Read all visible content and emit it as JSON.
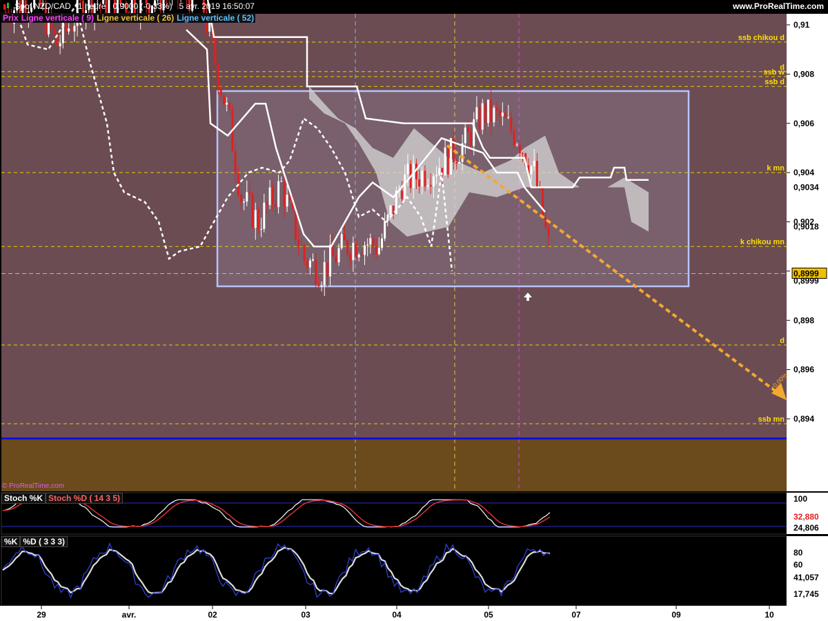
{
  "header": {
    "instrument": "Spot NZD/CAD",
    "timeframe": "1 heure",
    "price_change": "0,9000 (-0,33%)",
    "datetime": "5 avr. 2019 16:50:07",
    "site": "www.ProRealTime.com"
  },
  "legend": {
    "prix": "Prix",
    "line9": "Ligne verticale ( 9)",
    "line26": "Ligne verticale ( 26)",
    "line52": "Ligne verticale ( 52)"
  },
  "copyright": "© ProRealTime.com",
  "colors": {
    "background_main": "#6b4c52",
    "background_low": "#6b4a1c",
    "support_line": "#1010e0",
    "level_line": "#e8d000",
    "projection_arrow": "#f4a830",
    "box": "#b8c4ff",
    "bull": "#ffffff",
    "bear": "#e02020"
  },
  "chart_data": [
    {
      "type": "candlestick",
      "name": "price",
      "ylim": [
        0.8925,
        0.9115
      ],
      "y_ticks": [
        "0,91",
        "0,908",
        "0,906",
        "0,904",
        "0,902",
        "0,9",
        "0,898",
        "0,896",
        "0,894"
      ],
      "x_ticks": [
        "29",
        "avr.",
        "02",
        "03",
        "04",
        "05",
        "07",
        "09",
        "10"
      ],
      "levels": [
        {
          "label": "ssb chikou d",
          "value": 0.9093
        },
        {
          "label": "d",
          "value": 0.9081
        },
        {
          "label": "ssb w",
          "value": 0.9079
        },
        {
          "label": "ssb d",
          "value": 0.9075
        },
        {
          "label": "k mn",
          "value": 0.904
        },
        {
          "label": "k chikou mn",
          "value": 0.901
        },
        {
          "label": "d",
          "value": 0.897
        },
        {
          "label": "ssb mn",
          "value": 0.8938
        }
      ],
      "price_labels": [
        {
          "text": "0,9034",
          "value": 0.9034
        },
        {
          "text": "0,9018",
          "value": 0.9018
        },
        {
          "text": "0,8999",
          "value": 0.8999,
          "highlight": true
        },
        {
          "text": "0,8999",
          "value": 0.8996
        }
      ],
      "support_level": 0.8932,
      "annotation": "+0,00%"
    },
    {
      "type": "line",
      "name": "Stoch %K / Stoch %D",
      "legend": [
        "Stoch %K",
        "Stoch %D ( 14 3 5)"
      ],
      "y_ticks": [
        "100"
      ],
      "y_labels": [
        "32,880",
        "24,806"
      ],
      "last_values": {
        "k": 32.88,
        "d": 24.806
      }
    },
    {
      "type": "line",
      "name": "%K / %D",
      "legend": [
        "%K",
        "%D ( 3 3 3)"
      ],
      "y_ticks": [
        "80",
        "60"
      ],
      "y_labels": [
        "41,057",
        "17,745"
      ],
      "last_values": {
        "k": 41.057,
        "d": 17.745
      }
    }
  ]
}
